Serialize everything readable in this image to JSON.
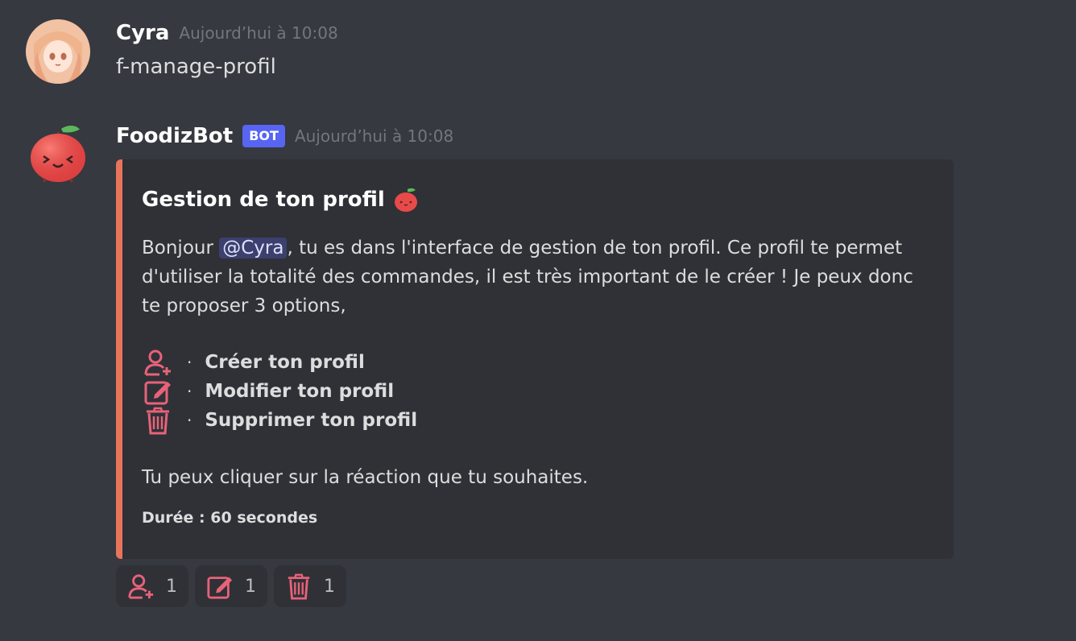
{
  "messages": [
    {
      "username": "Cyra",
      "timestamp": "Aujourd’hui à 10:08",
      "text": "f-manage-profil",
      "avatar_icon": "user-avatar-icon"
    },
    {
      "username": "FoodizBot",
      "bot_tag": "BOT",
      "timestamp": "Aujourd’hui à 10:08",
      "avatar_icon": "apple-avatar-icon",
      "embed": {
        "accent_color": "#e8745c",
        "title": "Gestion de ton profil",
        "title_icon": "apple-icon",
        "desc_before": "Bonjour ",
        "mention": "@Cyra",
        "desc_after": ", tu es dans l'interface de gestion de ton profil. Ce profil te permet d'utiliser la totalité des commandes, il est très important de le créer ! Je peux donc te proposer 3 options,",
        "options": [
          {
            "icon": "user-plus-icon",
            "label": "Créer ton profil"
          },
          {
            "icon": "edit-icon",
            "label": "Modifier ton profil"
          },
          {
            "icon": "trash-icon",
            "label": "Supprimer ton profil"
          }
        ],
        "bullet": "·",
        "closing": "Tu peux cliquer sur la réaction que tu souhaites.",
        "footer": "Durée : 60 secondes"
      },
      "reactions": [
        {
          "icon": "user-plus-icon",
          "count": "1"
        },
        {
          "icon": "edit-icon",
          "count": "1"
        },
        {
          "icon": "trash-icon",
          "count": "1"
        }
      ]
    }
  ],
  "colors": {
    "background": "#36393f",
    "embed_bg": "#2f3136",
    "icon_pink": "#e8627a",
    "bot_tag": "#5865f2"
  }
}
